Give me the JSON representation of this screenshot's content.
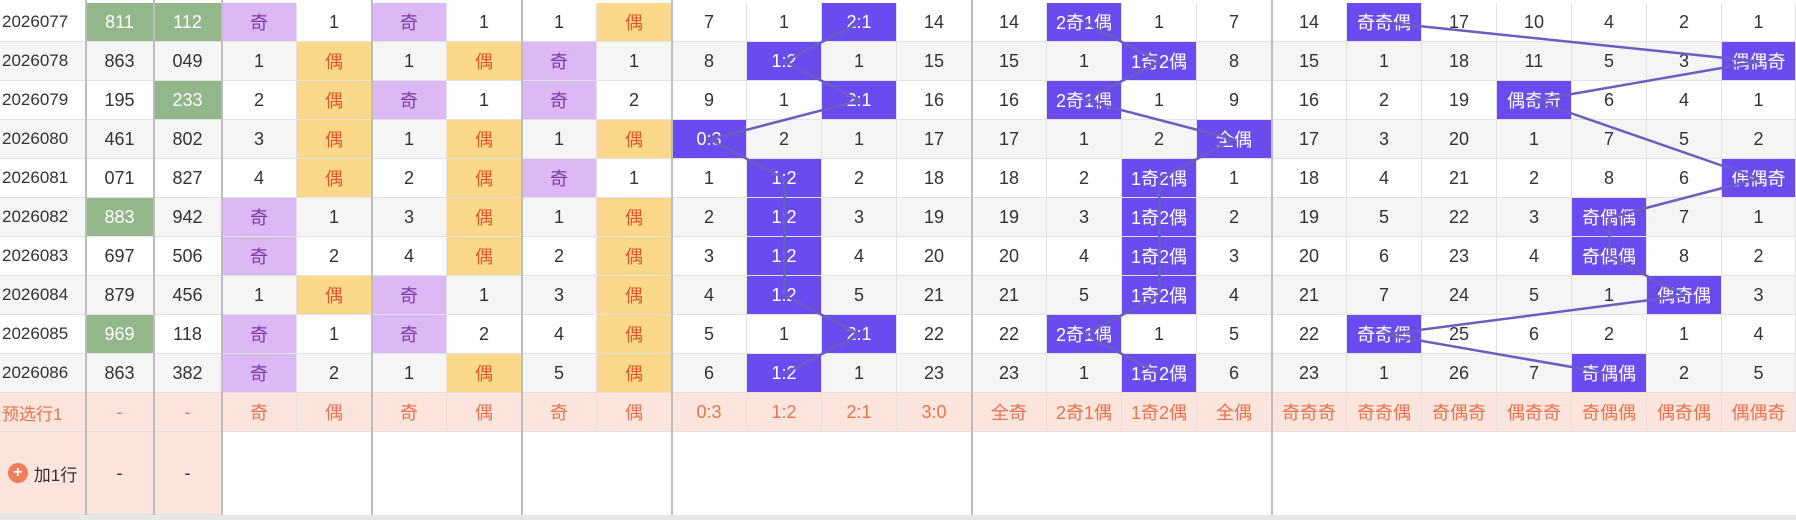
{
  "rows": [
    {
      "period": "2026077",
      "n1": "811",
      "n2": "112",
      "c": [
        "奇",
        "1",
        "奇",
        "1",
        "1",
        "偶",
        "7",
        "1",
        "2:1",
        "14",
        "14",
        "2奇1偶",
        "1",
        "7",
        "14",
        "奇奇偶",
        "17",
        "10",
        "4",
        "2",
        "1"
      ]
    },
    {
      "period": "2026078",
      "n1": "863",
      "n2": "049",
      "c": [
        "1",
        "偶",
        "1",
        "偶",
        "奇",
        "1",
        "8",
        "1:2",
        "1",
        "15",
        "15",
        "1",
        "1奇2偶",
        "8",
        "15",
        "1",
        "18",
        "11",
        "5",
        "3",
        "偶偶奇"
      ]
    },
    {
      "period": "2026079",
      "n1": "195",
      "n2": "233",
      "c": [
        "2",
        "偶",
        "奇",
        "1",
        "奇",
        "2",
        "9",
        "1",
        "2:1",
        "16",
        "16",
        "2奇1偶",
        "1",
        "9",
        "16",
        "2",
        "19",
        "偶奇奇",
        "6",
        "4",
        "1"
      ]
    },
    {
      "period": "2026080",
      "n1": "461",
      "n2": "802",
      "c": [
        "3",
        "偶",
        "1",
        "偶",
        "1",
        "偶",
        "0:3",
        "2",
        "1",
        "17",
        "17",
        "1",
        "2",
        "全偶",
        "17",
        "3",
        "20",
        "1",
        "7",
        "5",
        "2"
      ]
    },
    {
      "period": "2026081",
      "n1": "071",
      "n2": "827",
      "c": [
        "4",
        "偶",
        "2",
        "偶",
        "奇",
        "1",
        "1",
        "1:2",
        "2",
        "18",
        "18",
        "2",
        "1奇2偶",
        "1",
        "18",
        "4",
        "21",
        "2",
        "8",
        "6",
        "偶偶奇"
      ]
    },
    {
      "period": "2026082",
      "n1": "883",
      "n2": "942",
      "c": [
        "奇",
        "1",
        "3",
        "偶",
        "1",
        "偶",
        "2",
        "1:2",
        "3",
        "19",
        "19",
        "3",
        "1奇2偶",
        "2",
        "19",
        "5",
        "22",
        "3",
        "奇偶偶",
        "7",
        "1"
      ]
    },
    {
      "period": "2026083",
      "n1": "697",
      "n2": "506",
      "c": [
        "奇",
        "2",
        "4",
        "偶",
        "2",
        "偶",
        "3",
        "1:2",
        "4",
        "20",
        "20",
        "4",
        "1奇2偶",
        "3",
        "20",
        "6",
        "23",
        "4",
        "奇偶偶",
        "8",
        "2"
      ]
    },
    {
      "period": "2026084",
      "n1": "879",
      "n2": "456",
      "c": [
        "1",
        "偶",
        "奇",
        "1",
        "3",
        "偶",
        "4",
        "1:2",
        "5",
        "21",
        "21",
        "5",
        "1奇2偶",
        "4",
        "21",
        "7",
        "24",
        "5",
        "1",
        "偶奇偶",
        "3"
      ]
    },
    {
      "period": "2026085",
      "n1": "969",
      "n2": "118",
      "c": [
        "奇",
        "1",
        "奇",
        "2",
        "4",
        "偶",
        "5",
        "1",
        "2:1",
        "22",
        "22",
        "2奇1偶",
        "1",
        "5",
        "22",
        "奇奇偶",
        "25",
        "6",
        "2",
        "1",
        "4"
      ]
    },
    {
      "period": "2026086",
      "n1": "863",
      "n2": "382",
      "c": [
        "奇",
        "2",
        "1",
        "偶",
        "5",
        "偶",
        "6",
        "1:2",
        "1",
        "23",
        "23",
        "1",
        "1奇2偶",
        "6",
        "23",
        "1",
        "26",
        "7",
        "奇偶偶",
        "2",
        "5"
      ]
    }
  ],
  "preselect": {
    "label": "预选行1",
    "n1": "-",
    "n2": "-",
    "c": [
      "奇",
      "偶",
      "奇",
      "偶",
      "奇",
      "偶",
      "0:3",
      "1:2",
      "2:1",
      "3:0",
      "全奇",
      "2奇1偶",
      "1奇2偶",
      "全偶",
      "奇奇奇",
      "奇奇偶",
      "奇偶奇",
      "偶奇奇",
      "奇偶偶",
      "偶奇偶",
      "偶偶奇"
    ]
  },
  "addrow": {
    "label": "加1行",
    "n1": "-",
    "n2": "-"
  },
  "green": {
    "n1": [
      0,
      5,
      8
    ],
    "n2": [
      0,
      2
    ]
  },
  "colors": {
    "green": "#93b78a",
    "odd": "#dcb8f4",
    "even": "#fcd98a",
    "blue": "#6a4bf0",
    "line": "#6a5fc0"
  }
}
